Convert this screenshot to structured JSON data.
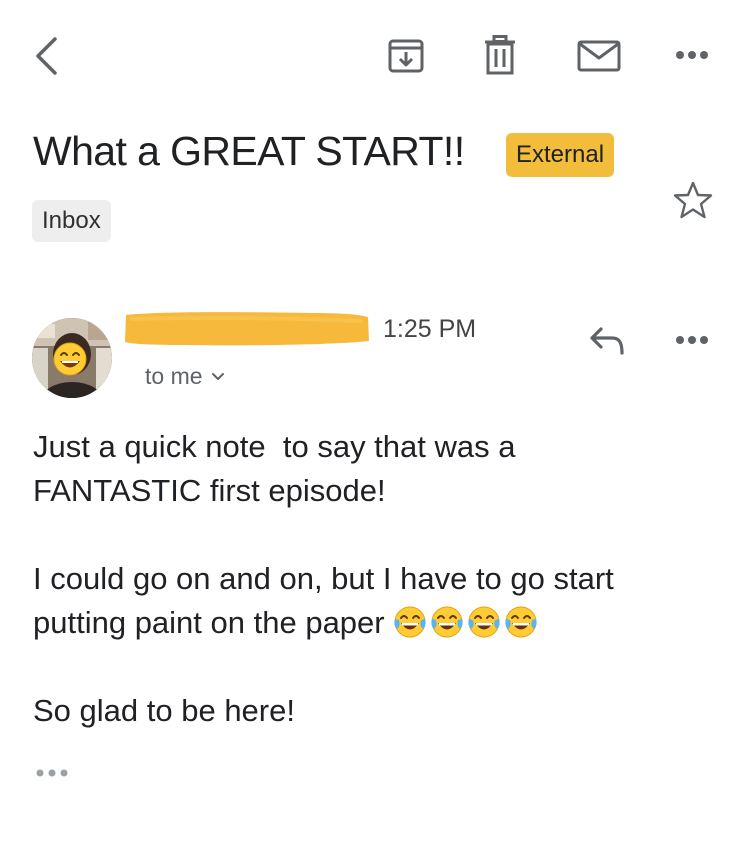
{
  "toolbar": {
    "back_icon": "back-arrow-icon",
    "archive_icon": "archive-icon",
    "delete_icon": "trash-icon",
    "mark_unread_icon": "mail-icon",
    "more_icon": "more-horizontal-icon"
  },
  "email": {
    "subject": "What a GREAT START!!",
    "external_badge": "External",
    "label": "Inbox",
    "time": "1:25 PM",
    "recipient": "to me",
    "body": {
      "line1": "Just a quick note  to say that was a",
      "line2": "FANTASTIC first episode!",
      "line3": "I could go on and on, but I have to go start",
      "line4": "putting paint on the paper",
      "line5": "So glad to be here!"
    },
    "emoji_count": 4
  },
  "colors": {
    "external_badge": "#f2bd3a",
    "redaction": "#f5b32a",
    "icon_gray": "#5f6368"
  }
}
